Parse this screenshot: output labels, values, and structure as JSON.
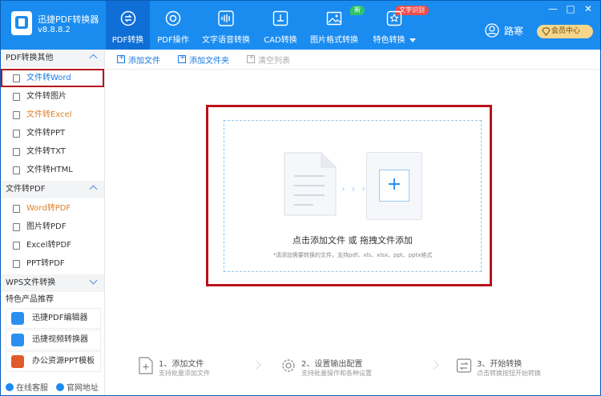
{
  "app": {
    "name": "迅捷PDF转换器",
    "version": "v8.8.8.2"
  },
  "nav": {
    "items": [
      {
        "label": "PDF转换",
        "icon": "convert-icon",
        "active": true
      },
      {
        "label": "PDF操作",
        "icon": "gear-icon"
      },
      {
        "label": "文字语音转换",
        "icon": "audio-wave-icon"
      },
      {
        "label": "CAD转换",
        "icon": "cad-icon"
      },
      {
        "label": "图片格式转换",
        "icon": "image-icon",
        "badge": "新"
      },
      {
        "label": "特色转换",
        "icon": "star-convert-icon",
        "badge": "文字识别",
        "dropdown": true
      }
    ]
  },
  "user": {
    "name": "路寒",
    "vip_label": "会员中心"
  },
  "window": {
    "minimize": "—",
    "maximize": "□",
    "close": "✕"
  },
  "sidebar": {
    "groups": [
      {
        "title": "PDF转换其他",
        "expanded": true,
        "items": [
          {
            "label": "文件转Word",
            "active": true
          },
          {
            "label": "文件转图片"
          },
          {
            "label": "文件转Excel",
            "highlight": true
          },
          {
            "label": "文件转PPT"
          },
          {
            "label": "文件转TXT"
          },
          {
            "label": "文件转HTML"
          }
        ]
      },
      {
        "title": "文件转PDF",
        "expanded": true,
        "items": [
          {
            "label": "Word转PDF",
            "highlight": true
          },
          {
            "label": "图片转PDF"
          },
          {
            "label": "Excel转PDF"
          },
          {
            "label": "PPT转PDF"
          }
        ]
      },
      {
        "title": "WPS文件转换",
        "expanded": false,
        "items": []
      }
    ],
    "featured_title": "特色产品推荐",
    "featured": [
      {
        "label": "迅捷PDF编辑器",
        "color": "#2a8ff0"
      },
      {
        "label": "迅捷视频转换器",
        "color": "#2a8ff0"
      },
      {
        "label": "办公资源PPT模板",
        "color": "#e05a2a"
      }
    ],
    "footer": {
      "service": "在线客服",
      "website": "官网地址"
    }
  },
  "toolbar": {
    "add_file": "添加文件",
    "add_folder": "添加文件夹",
    "clear_list": "清空列表"
  },
  "dropzone": {
    "title": "点击添加文件 或 拖拽文件添加",
    "hint": "*请添加需要转换的文件，支持pdf、xls、xlsx、ppt、pptx格式",
    "arrows": "› › ›",
    "plus": "+"
  },
  "steps": [
    {
      "title": "1、添加文件",
      "sub": "支持批量添加文件"
    },
    {
      "title": "2、设置输出配置",
      "sub": "支持批量操作和各种设置"
    },
    {
      "title": "3、开始转换",
      "sub": "点击转换按钮开始转换"
    }
  ],
  "colors": {
    "brand": "#1a8cf0",
    "nav_active": "#0f6fd6",
    "highlight_frame": "#b8121b",
    "orange_text": "#e0802a"
  }
}
